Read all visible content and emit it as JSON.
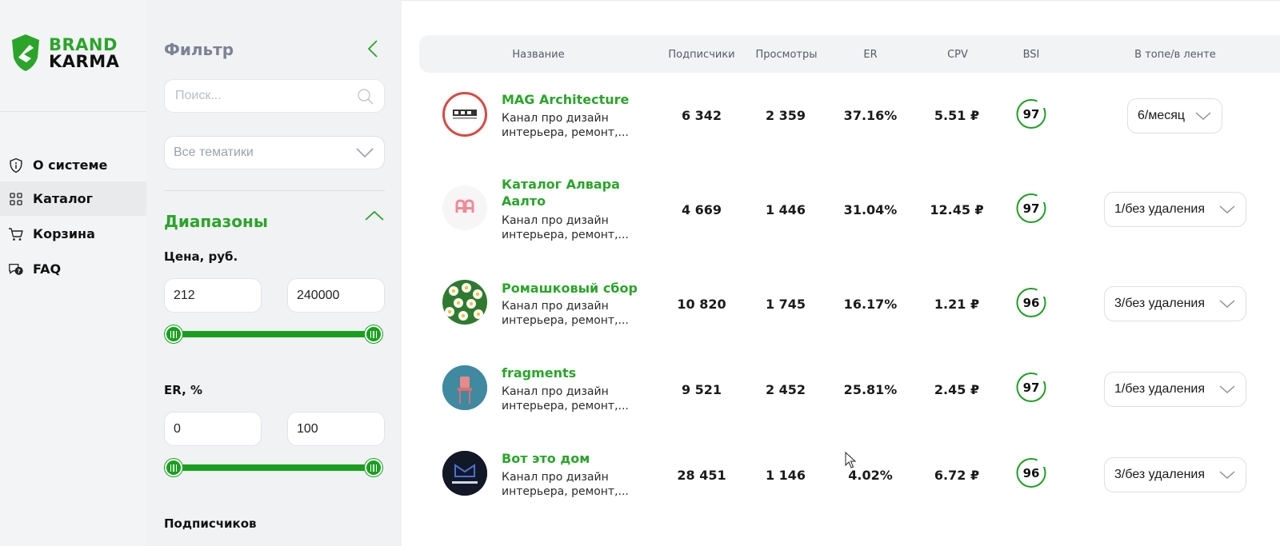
{
  "brand": {
    "line1": "BRAND",
    "line2": "KARMA",
    "color": "#2aa52a"
  },
  "nav": {
    "items": [
      {
        "label": "О системе",
        "icon": "info-shield-icon"
      },
      {
        "label": "Каталог",
        "icon": "grid-icon",
        "active": true
      },
      {
        "label": "Корзина",
        "icon": "cart-icon"
      },
      {
        "label": "FAQ",
        "icon": "chat-question-icon"
      }
    ]
  },
  "filter": {
    "title": "Фильтр",
    "search_placeholder": "Поиск...",
    "topics_value": "Все тематики",
    "ranges_title": "Диапазоны",
    "price": {
      "label": "Цена, руб.",
      "min": "212",
      "max": "240000"
    },
    "er": {
      "label": "ER, %",
      "min": "0",
      "max": "100"
    },
    "subscribers_label": "Подписчиков"
  },
  "table": {
    "headers": {
      "name": "Название",
      "subscribers": "Подписчики",
      "views": "Просмотры",
      "er": "ER",
      "cpv": "CPV",
      "bsi": "BSI",
      "top": "В топе/в ленте"
    },
    "rows": [
      {
        "name": "MAG Architecture",
        "desc": "Канал про дизайн интерьера, ремонт,...",
        "subscribers": "6 342",
        "views": "2 359",
        "er": "37.16%",
        "cpv": "5.51 ₽",
        "bsi": "97",
        "top": "6/месяц",
        "avatar": "mag-architecture-avatar"
      },
      {
        "name": "Каталог Алвара Аалто",
        "desc": "Канал про дизайн интерьера, ремонт,...",
        "subscribers": "4 669",
        "views": "1 446",
        "er": "31.04%",
        "cpv": "12.45 ₽",
        "bsi": "97",
        "top": "1/без удаления",
        "avatar": "catalog-aalto-avatar"
      },
      {
        "name": "Ромашковый сбор",
        "desc": "Канал про дизайн интерьера, ремонт,...",
        "subscribers": "10 820",
        "views": "1 745",
        "er": "16.17%",
        "cpv": "1.21 ₽",
        "bsi": "96",
        "top": "3/без удаления",
        "avatar": "daisy-avatar"
      },
      {
        "name": "fragments",
        "desc": "Канал про дизайн интерьера, ремонт,...",
        "subscribers": "9 521",
        "views": "2 452",
        "er": "25.81%",
        "cpv": "2.45 ₽",
        "bsi": "97",
        "top": "1/без удаления",
        "avatar": "fragments-chair-avatar"
      },
      {
        "name": "Вот это дом",
        "desc": "Канал про дизайн интерьера, ремонт,...",
        "subscribers": "28 451",
        "views": "1 146",
        "er": "4.02%",
        "cpv": "6.72 ₽",
        "bsi": "96",
        "top": "3/без удаления",
        "avatar": "wow-dom-avatar"
      }
    ]
  }
}
